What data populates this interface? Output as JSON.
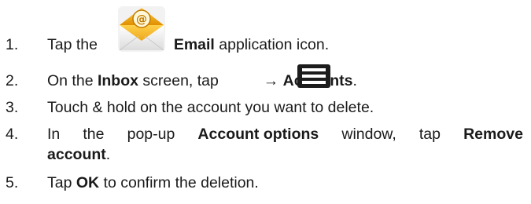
{
  "steps": [
    {
      "num": "1.",
      "pre": "Tap the",
      "bold": "Email",
      "post": "application icon.",
      "icon": "email-app-icon"
    },
    {
      "num": "2.",
      "pre": "On the",
      "bold1": "Inbox",
      "mid": "screen, tap",
      "arrow": "→",
      "bold2": "Accounts",
      "post": ".",
      "icon": "menu-icon"
    },
    {
      "num": "3.",
      "text": "Touch & hold on the account you want to delete."
    },
    {
      "num": "4.",
      "w1": "In",
      "w2": "the",
      "w3": "pop-up",
      "bold1": "Account options",
      "w4": "window,",
      "w5": "tap",
      "bold2": "Remove",
      "bold3": "account",
      "post": "."
    },
    {
      "num": "5.",
      "pre": "Tap",
      "bold": "OK",
      "post": "to confirm the deletion."
    }
  ],
  "colors": {
    "text": "#1a1a1a",
    "icon_envelope": "#e9a400",
    "icon_menu": "#1c1c1c"
  }
}
